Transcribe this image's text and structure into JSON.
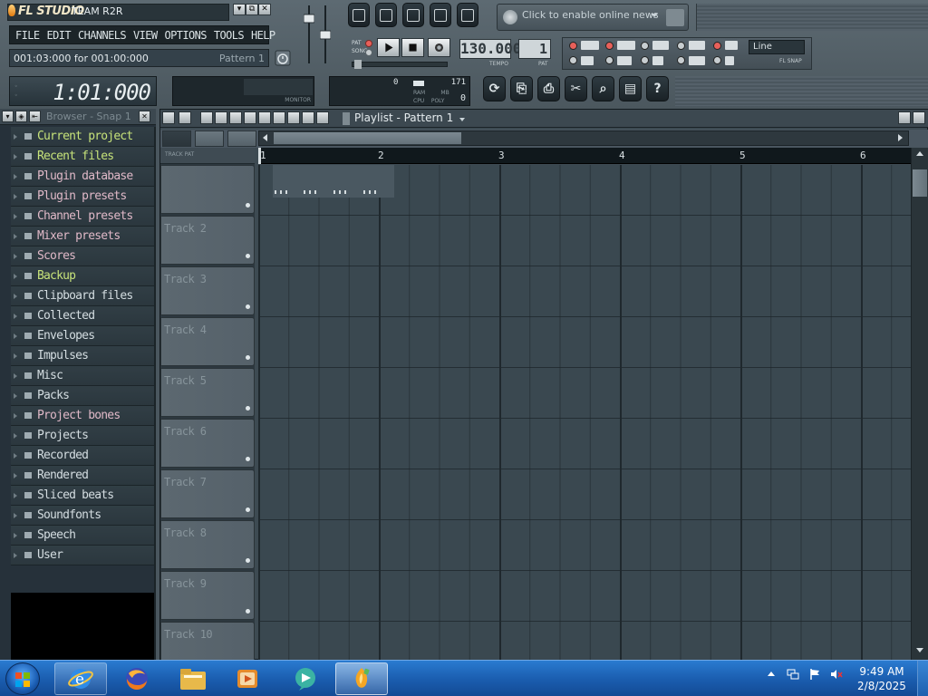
{
  "window": {
    "app_logo": "FL STUDIO",
    "title": "TEAM R2R",
    "controls": [
      "▾",
      "⧉",
      "✕"
    ]
  },
  "menu": [
    "FILE",
    "EDIT",
    "CHANNELS",
    "VIEW",
    "OPTIONS",
    "TOOLS",
    "HELP"
  ],
  "hint_bar": {
    "time_text": "001:03:000 for 001:00:000",
    "pattern_text": "Pattern 1"
  },
  "news": {
    "text": "Click to enable online news"
  },
  "transport": {
    "pat_label": "PAT",
    "song_label": "SONG",
    "tempo": "130.000",
    "tempo_label": "TEMPO",
    "pattern_number": "1",
    "pattern_label": "PAT"
  },
  "snap": {
    "value": "Line",
    "label": "FL SNAP"
  },
  "time_display": {
    "value": "1:01:000"
  },
  "monitor": {
    "label": "MONITOR"
  },
  "cpu_panel": {
    "ram_value": "0",
    "cpu_value": "171",
    "ram_label": "RAM",
    "mb_label": "MB",
    "cpu_label": "CPU",
    "poly_label": "POLY",
    "poly_value": "0"
  },
  "tool_buttons": [
    "⟳",
    "⎘",
    "⎙",
    "✂",
    "⌕",
    "▤",
    "?"
  ],
  "browser": {
    "title": "Browser - Snap 1",
    "items": [
      {
        "label": "Current project",
        "color": "green"
      },
      {
        "label": "Recent files",
        "color": "green"
      },
      {
        "label": "Plugin database",
        "color": "pink"
      },
      {
        "label": "Plugin presets",
        "color": "pink"
      },
      {
        "label": "Channel presets",
        "color": "pink"
      },
      {
        "label": "Mixer presets",
        "color": "pink"
      },
      {
        "label": "Scores",
        "color": "pink"
      },
      {
        "label": "Backup",
        "color": "green"
      },
      {
        "label": "Clipboard files",
        "color": "plain"
      },
      {
        "label": "Collected",
        "color": "plain"
      },
      {
        "label": "Envelopes",
        "color": "plain"
      },
      {
        "label": "Impulses",
        "color": "plain"
      },
      {
        "label": "Misc",
        "color": "plain"
      },
      {
        "label": "Packs",
        "color": "plain"
      },
      {
        "label": "Project bones",
        "color": "pink"
      },
      {
        "label": "Projects",
        "color": "plain"
      },
      {
        "label": "Recorded",
        "color": "plain"
      },
      {
        "label": "Rendered",
        "color": "plain"
      },
      {
        "label": "Sliced beats",
        "color": "plain"
      },
      {
        "label": "Soundfonts",
        "color": "plain"
      },
      {
        "label": "Speech",
        "color": "plain"
      },
      {
        "label": "User",
        "color": "plain"
      }
    ]
  },
  "playlist": {
    "title": "Playlist - Pattern 1",
    "track_header": "TRACK PAT",
    "bars": [
      "1",
      "2",
      "3",
      "4",
      "5",
      "6"
    ],
    "tracks": [
      "",
      "Track 2",
      "Track 3",
      "Track 4",
      "Track 5",
      "Track 6",
      "Track 7",
      "Track 8",
      "Track 9",
      "Track 10"
    ]
  },
  "taskbar": {
    "time": "9:49 AM",
    "date": "2/8/2025"
  },
  "colors": {
    "browser_green": "#c7e37a",
    "browser_pink": "#e0b9c8",
    "browser_plain": "#d4dde1",
    "grid": "#3a4850",
    "taskbar": "#1a5cae"
  }
}
